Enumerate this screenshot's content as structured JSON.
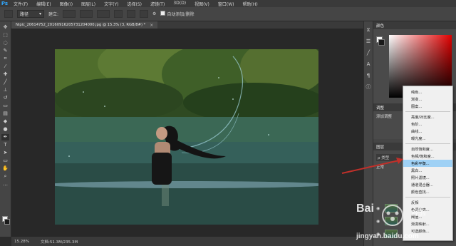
{
  "menubar": {
    "logo": "Ps",
    "items": [
      "文件(F)",
      "编辑(E)",
      "图像(I)",
      "图层(L)",
      "文字(Y)",
      "选择(S)",
      "滤镜(T)",
      "3D(D)",
      "视图(V)",
      "窗口(W)",
      "帮助(H)"
    ]
  },
  "options": {
    "path_mode": "路径",
    "make_label": "建立:",
    "auto_add_delete": "自动添加/删除"
  },
  "document": {
    "tab_title": "Nipic_20614752_20160916205731204000.jpg @ 15.3% (3, RGB/8#) *",
    "zoom": "15.28%",
    "doc_info": "文档:51.3M/235.3M"
  },
  "panels": {
    "color_tab": "颜色",
    "adjust_tab": "调整",
    "adjust_subtitle": "添加调整",
    "layers_tab": "图层",
    "layers_filter": "ρ 类型",
    "layers_mode_short": "正常"
  },
  "adjustment_menu": {
    "items": [
      {
        "label": "纯色..."
      },
      {
        "label": "渐变..."
      },
      {
        "label": "图案..."
      },
      {
        "sep": true
      },
      {
        "label": "亮度/对比度..."
      },
      {
        "label": "色阶..."
      },
      {
        "label": "曲线..."
      },
      {
        "label": "曝光度..."
      },
      {
        "sep": true
      },
      {
        "label": "自然饱和度..."
      },
      {
        "label": "色相/饱和度..."
      },
      {
        "label": "色彩平衡...",
        "active": true
      },
      {
        "label": "黑白..."
      },
      {
        "label": "照片滤镜..."
      },
      {
        "label": "通道混合器..."
      },
      {
        "label": "颜色查找..."
      },
      {
        "sep": true
      },
      {
        "label": "反相"
      },
      {
        "label": "色调分离..."
      },
      {
        "label": "阈值..."
      },
      {
        "label": "渐变映射..."
      },
      {
        "label": "可选颜色..."
      }
    ]
  },
  "watermark": {
    "brand": "Bai",
    "brand_suffix": "经验",
    "url": "jingyan.baidu.com"
  },
  "colors": {
    "accent_selected": "#9fd1f5",
    "arrow": "#c0302a"
  }
}
